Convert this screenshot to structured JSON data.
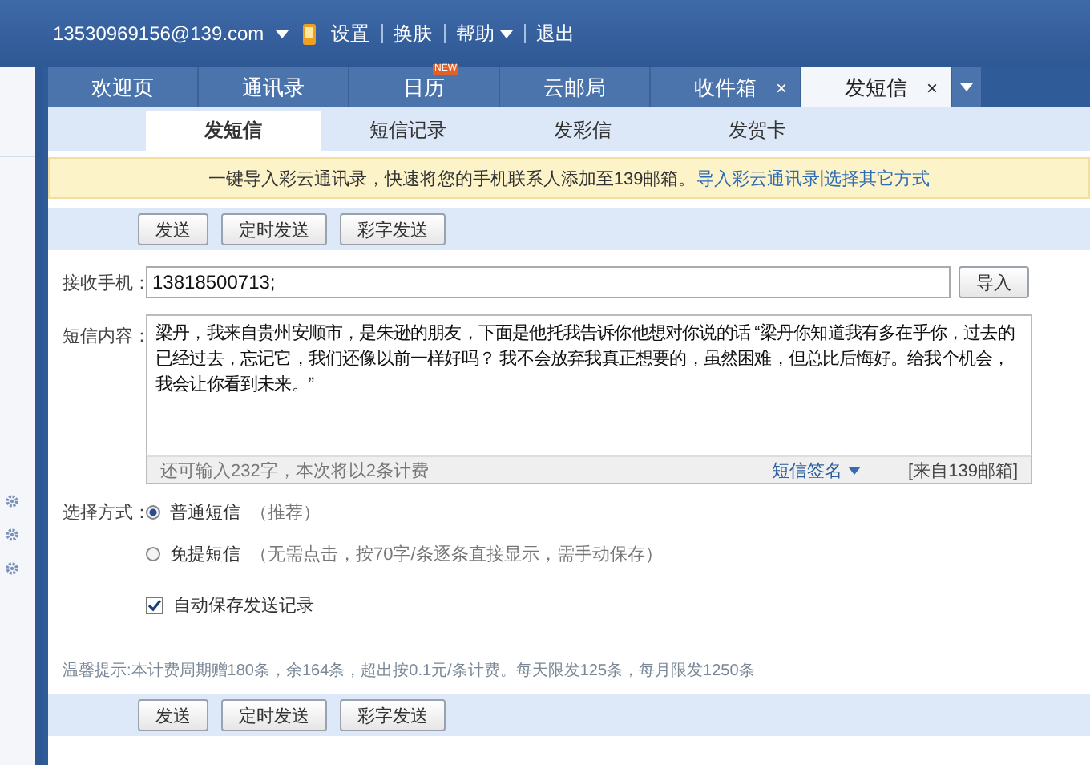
{
  "top_bar": {
    "account": "13530969156@139.com",
    "links": [
      {
        "label": "设置",
        "has_menu": false
      },
      {
        "label": "换肤",
        "has_menu": false
      },
      {
        "label": "帮助",
        "has_menu": true
      },
      {
        "label": "退出",
        "has_menu": false
      }
    ]
  },
  "tabs": [
    {
      "label": "欢迎页",
      "selected": false
    },
    {
      "label": "通讯录",
      "selected": false
    },
    {
      "label": "日历",
      "selected": false,
      "badge": "NEW"
    },
    {
      "label": "云邮局",
      "selected": false
    },
    {
      "label": "收件箱",
      "selected": false,
      "close": "×"
    },
    {
      "label": "发短信",
      "selected": true,
      "close": "×"
    }
  ],
  "sub_tabs": [
    {
      "label": "发短信",
      "selected": true
    },
    {
      "label": "短信记录",
      "selected": false
    },
    {
      "label": "发彩信",
      "selected": false
    },
    {
      "label": "发贺卡",
      "selected": false
    }
  ],
  "notice": {
    "text": "一键导入彩云通讯录，快速将您的手机联系人添加至139邮箱。",
    "links": [
      "导入彩云通讯录",
      "选择其它方式"
    ],
    "separator": "|"
  },
  "toolbar_buttons": [
    "发送",
    "定时发送",
    "彩字发送"
  ],
  "recipient": {
    "label": "接收手机：",
    "value": "13818500713;",
    "button": "导入"
  },
  "message": {
    "label": "短信内容：",
    "value": "梁丹，我来自贵州安顺市，是朱逊的朋友，下面是他托我告诉你他想对你说的话 “梁丹你知道我有多在乎你，过去的已经过去，忘记它，我们还像以前一样好吗？ 我不会放弃我真正想要的，虽然困难，但总比后悔好。给我个机会，我会让你看到未来。”",
    "remaining": "还可输入232字，本次将以2条计费",
    "signature": "短信签名",
    "source": "[来自139邮箱]"
  },
  "send_mode": {
    "label": "选择方式：",
    "options": [
      {
        "label": "普通短信",
        "note": "（推荐）",
        "selected": true
      },
      {
        "label": "免提短信",
        "note": "（无需点击，按70字/条逐条直接显示，需手动保存）",
        "selected": false
      }
    ]
  },
  "auto_save": {
    "label": "自动保存发送记录",
    "checked": true
  },
  "tip": "温馨提示:本计费周期赠180条，余164条，超出按0.1元/条计费。每天限发125条，每月限发1250条",
  "bottom_buttons": [
    "发送",
    "定时发送",
    "彩字发送"
  ]
}
